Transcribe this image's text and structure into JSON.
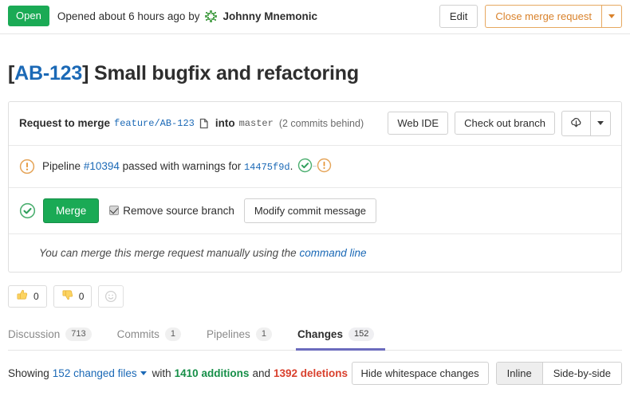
{
  "header": {
    "state_label": "Open",
    "state_color": "#1aaa55",
    "opened_text": "Opened about 6 hours ago by",
    "author": "Johnny Mnemonic",
    "avatar_icon": "identicon-avatar",
    "edit_label": "Edit",
    "close_label": "Close merge request",
    "close_caret_icon": "chevron-down-icon"
  },
  "title": {
    "ref": "[AB-123]",
    "ref_open": "[",
    "ref_id": "AB-123",
    "ref_close": "]",
    "text": "Small bugfix and refactoring",
    "full": "[AB-123] Small bugfix and refactoring"
  },
  "merge_widget": {
    "head": {
      "request_label": "Request to merge",
      "source_branch": "feature/AB-123",
      "copy_icon": "copy-branch-icon",
      "into_label": "into",
      "target_branch": "master",
      "behind_note": "(2 commits behind)",
      "web_ide_label": "Web IDE",
      "checkout_label": "Check out branch",
      "download_icon": "download-cloud-icon",
      "download_caret_icon": "chevron-down-icon"
    },
    "pipeline": {
      "status_icon": "warning-circle-icon",
      "prefix": "Pipeline",
      "pipeline_id": "#10394",
      "middle": "passed with warnings for",
      "commit_sha": "14475f9d",
      "period": ".",
      "stage_icons": [
        "success-check-icon",
        "warning-circle-icon"
      ]
    },
    "merge": {
      "status_icon": "success-check-icon",
      "merge_label": "Merge",
      "remove_branch_label": "Remove source branch",
      "remove_branch_checked": true,
      "modify_commit_label": "Modify commit message"
    },
    "note": {
      "text": "You can merge this merge request manually using the",
      "link_text": "command line"
    }
  },
  "awards": [
    {
      "icon": "thumbs-up-icon",
      "emoji": "👍",
      "count": "0"
    },
    {
      "icon": "thumbs-down-icon",
      "emoji": "👎",
      "count": "0"
    }
  ],
  "award_add": {
    "icon": "add-reaction-smiley-icon",
    "emoji": "☺"
  },
  "tabs": [
    {
      "label": "Discussion",
      "count": "713",
      "active": false
    },
    {
      "label": "Commits",
      "count": "1",
      "active": false
    },
    {
      "label": "Pipelines",
      "count": "1",
      "active": false
    },
    {
      "label": "Changes",
      "count": "152",
      "active": true
    }
  ],
  "summary": {
    "showing_label": "Showing",
    "changed_files": "152 changed files",
    "caret_icon": "chevron-down-icon",
    "with_label": "with",
    "additions": "1410 additions",
    "and_label": "and",
    "deletions": "1392 deletions",
    "hide_whitespace_label": "Hide whitespace changes",
    "view_modes": [
      {
        "label": "Inline",
        "active": true
      },
      {
        "label": "Side-by-side",
        "active": false
      }
    ]
  },
  "colors": {
    "green": "#1aaa55",
    "orange": "#d9822b",
    "blue_link": "#1b69b6",
    "addition_green": "#168f48",
    "deletion_red": "#d9412e",
    "tab_active_underline": "#6b6bbd"
  }
}
